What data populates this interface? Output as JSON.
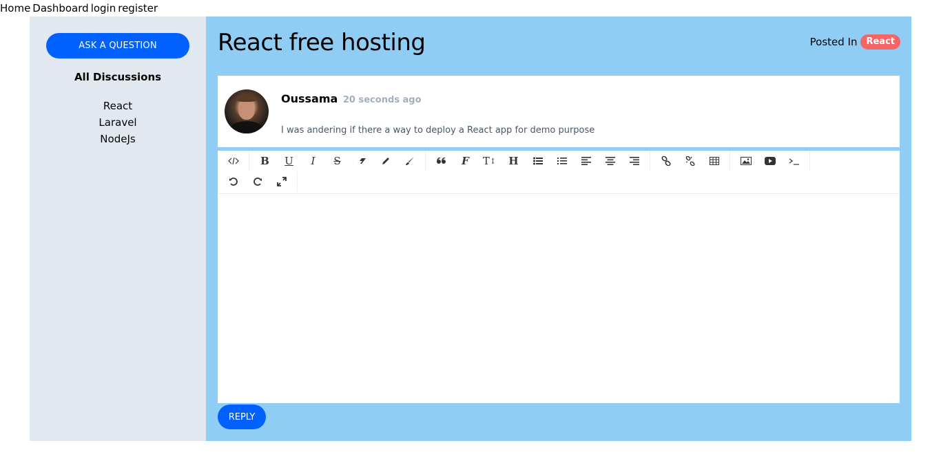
{
  "nav": {
    "home": "Home",
    "dashboard": "Dashboard",
    "login": "login",
    "register": "register"
  },
  "sidebar": {
    "ask_button": "ASK A QUESTION",
    "all_discussions": "All Discussions",
    "channels": [
      "React",
      "Laravel",
      "NodeJs"
    ]
  },
  "discussion": {
    "title": "React free hosting",
    "posted_in_label": "Posted In",
    "channel_badge": "React",
    "author": "Oussama",
    "time": "20 seconds ago",
    "body": "I was andering if there a way to deploy a React app for demo purpose"
  },
  "editor": {
    "toolbar_icons": [
      "code-view-icon",
      "bold-icon",
      "underline-icon",
      "italic-icon",
      "strikethrough-icon",
      "eraser-icon",
      "pencil-icon",
      "brush-icon",
      "quote-icon",
      "font-family-icon",
      "font-size-icon",
      "heading-icon",
      "bullet-list-icon",
      "numbered-list-icon",
      "align-left-icon",
      "align-center-icon",
      "align-right-icon",
      "link-icon",
      "unlink-icon",
      "table-icon",
      "image-icon",
      "video-icon",
      "terminal-icon",
      "undo-icon",
      "redo-icon",
      "fullscreen-icon"
    ]
  },
  "reply_button": "REPLY",
  "colors": {
    "accent": "#0061ff",
    "badge": "#f56565",
    "main_bg": "#90cdf4",
    "sidebar_bg": "#e2e8f0"
  }
}
